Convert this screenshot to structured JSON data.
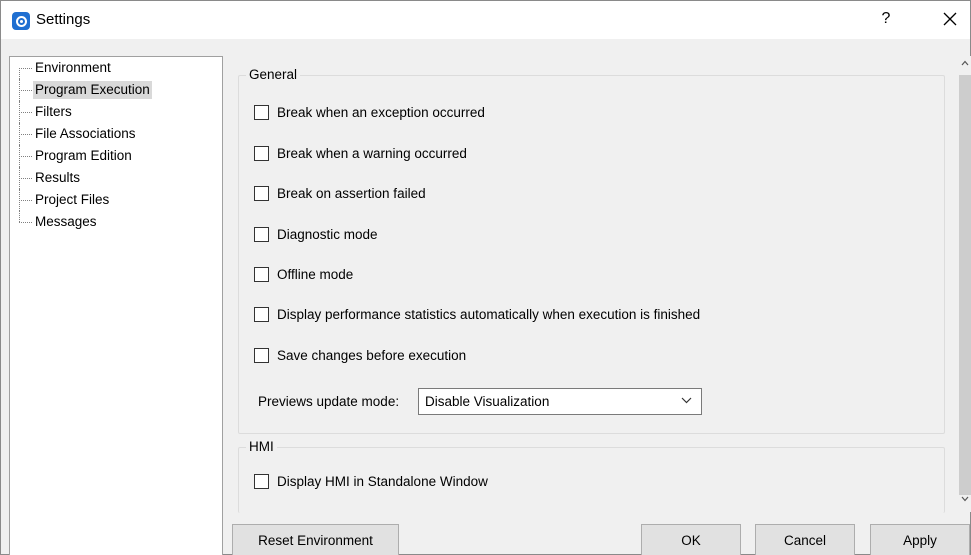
{
  "window": {
    "title": "Settings",
    "help_label": "?",
    "brand_color": "#1f6fd1"
  },
  "tree": {
    "items": [
      {
        "label": "Environment",
        "selected": false
      },
      {
        "label": "Program Execution",
        "selected": true
      },
      {
        "label": "Filters",
        "selected": false
      },
      {
        "label": "File Associations",
        "selected": false
      },
      {
        "label": "Program Edition",
        "selected": false
      },
      {
        "label": "Results",
        "selected": false
      },
      {
        "label": "Project Files",
        "selected": false
      },
      {
        "label": "Messages",
        "selected": false
      }
    ]
  },
  "general": {
    "title": "General",
    "options": [
      {
        "label": "Break when an exception occurred",
        "checked": false
      },
      {
        "label": "Break when a warning occurred",
        "checked": false
      },
      {
        "label": "Break on assertion failed",
        "checked": false
      },
      {
        "label": "Diagnostic mode",
        "checked": false
      },
      {
        "label": "Offline mode",
        "checked": false
      },
      {
        "label": "Display performance statistics automatically when execution is finished",
        "checked": false
      },
      {
        "label": "Save changes before execution",
        "checked": false
      }
    ],
    "previews_label": "Previews update mode:",
    "previews_value": "Disable Visualization"
  },
  "hmi": {
    "title": "HMI",
    "options": [
      {
        "label": "Display HMI in Standalone Window",
        "checked": false
      }
    ]
  },
  "buttons": {
    "reset": "Reset Environment",
    "ok": "OK",
    "cancel": "Cancel",
    "apply": "Apply"
  }
}
